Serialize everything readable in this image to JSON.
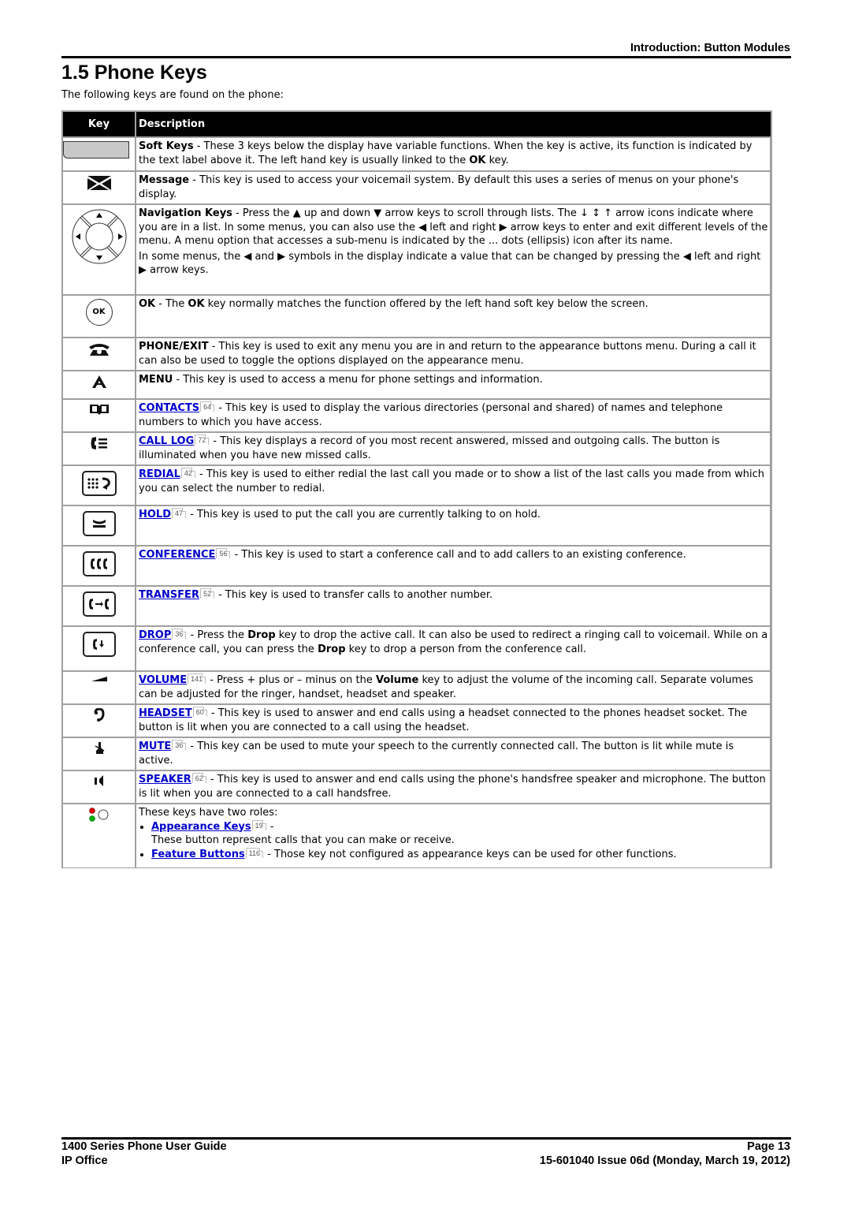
{
  "header": {
    "section": "Introduction: Button Modules"
  },
  "page_title": "1.5 Phone Keys",
  "intro": "The following keys are found on the phone:",
  "table": {
    "columns": [
      "Key",
      "Description"
    ],
    "rows": [
      {
        "icon": "soft-key",
        "name": "Soft Keys",
        "text": " - These 3 keys below the display have variable functions. When the key is active, its function is indicated by the text label above it. The left hand key is usually linked to the ",
        "bold2": "OK",
        "text2": " key."
      },
      {
        "icon": "message-envelope",
        "name": "Message",
        "text": " - This key is used to access your voicemail system. By default this uses a series of menus on your phone's display."
      },
      {
        "icon": "navigation-cluster",
        "name": "Navigation Keys",
        "p1_a": " - Press the ",
        "up_glyph": "▲",
        "p1_b": " up and down ",
        "down_glyph": "▼",
        "p1_c": " arrow keys to scroll through lists. The ↓ ↕ ↑ arrow icons indicate where you are in a list. In some menus, you can also use the ",
        "left_glyph": "◀",
        "p1_d": " left and right ",
        "right_glyph": "▶",
        "p1_e": " arrow keys to enter and exit different levels of the menu. A menu option that accesses a sub-menu is indicated by the ... dots (ellipsis) icon after its name.",
        "p2_a": "In some menus, the ",
        "p2_b": " and ",
        "p2_c": " symbols in the display indicate a value that can be changed by pressing the ",
        "p2_d": " left and right ",
        "p2_e": " arrow keys."
      },
      {
        "icon": "ok-key",
        "icon_label": "OK",
        "name": "OK",
        "text_a": " - The ",
        "bold2": "OK",
        "text_b": " key normally matches the function offered by the left hand soft key below the screen."
      },
      {
        "icon": "phone-exit",
        "name": "PHONE/EXIT",
        "text": " - This key is used to exit any menu you are in and return to the appearance buttons menu. During a call it can also be used to toggle the options displayed on the appearance menu."
      },
      {
        "icon": "menu-a",
        "name": "MENU",
        "text": " - This key is used to access a menu for phone settings and information."
      },
      {
        "icon": "contacts-book",
        "name": "CONTACTS",
        "ref": "64",
        "text": " - This key is used to display the various directories (personal and shared) of names and telephone numbers to which you have access."
      },
      {
        "icon": "call-log",
        "name": "CALL LOG",
        "ref": "72",
        "text": " - This key displays a record of you most recent answered, missed and outgoing calls. The button is illuminated when you have new missed calls."
      },
      {
        "icon": "redial",
        "name": "REDIAL",
        "ref": "42",
        "text": " - This key is used to either redial the last call you made or to show a list of the last calls you made from which you can select the number to redial."
      },
      {
        "icon": "hold",
        "name": "HOLD",
        "ref": "47",
        "text": " - This key is used to put the call you are currently talking to on hold."
      },
      {
        "icon": "conference",
        "name": "CONFERENCE",
        "ref": "56",
        "text": " - This key is used to start a conference call and to add callers to an existing conference."
      },
      {
        "icon": "transfer",
        "name": "TRANSFER",
        "ref": "52",
        "text": " - This key is used to transfer calls to another number."
      },
      {
        "icon": "drop",
        "name": "DROP",
        "ref": "36",
        "text_a": " - Press the ",
        "bold2": "Drop",
        "text_b": " key to drop the active call. It can also be used to redirect a ringing call to voicemail. While on a conference call, you can press the ",
        "bold3": "Drop",
        "text_c": " key to drop a person from the conference call."
      },
      {
        "icon": "volume",
        "name": "VOLUME",
        "ref": "141",
        "text_a": " - Press + plus or – minus on the ",
        "bold2": "Volume",
        "text_b": " key to adjust the volume of the incoming call. Separate volumes can be adjusted for the ringer, handset, headset and speaker."
      },
      {
        "icon": "headset",
        "name": "HEADSET",
        "ref": "60",
        "text": " - This key is used to answer and end calls using a headset connected to the phones headset socket. The button is lit when you are connected to a call using the headset."
      },
      {
        "icon": "mute",
        "name": "MUTE",
        "ref": "36",
        "text": " - This key can be used to mute your speech to the currently connected call. The button is lit while mute is active."
      },
      {
        "icon": "speaker",
        "name": "SPEAKER",
        "ref": "62",
        "text": " - This key is used to answer and end calls using the phone's handsfree speaker and microphone. The button is lit when you are connected to a call handsfree."
      },
      {
        "icon": "appearance-leds",
        "intro": "These keys have two roles:",
        "items": [
          {
            "name": "Appearance Keys",
            "ref": "19",
            "text": " -",
            "subtext": "These button represent calls that you can make or receive."
          },
          {
            "name": "Feature Buttons",
            "ref": "116",
            "text": " - Those key not configured as appearance keys can be used for other functions."
          }
        ]
      }
    ]
  },
  "colors": {
    "link": "#0000cc",
    "header_bg": "#000000",
    "border": "#a0a0a0",
    "led_red": "#e00000",
    "led_green": "#00b000"
  },
  "footer": {
    "left_line1": "1400 Series Phone User Guide",
    "left_line2": "IP Office",
    "right_line1": "Page 13",
    "right_line2": "15-601040 Issue 06d (Monday, March 19, 2012)"
  }
}
